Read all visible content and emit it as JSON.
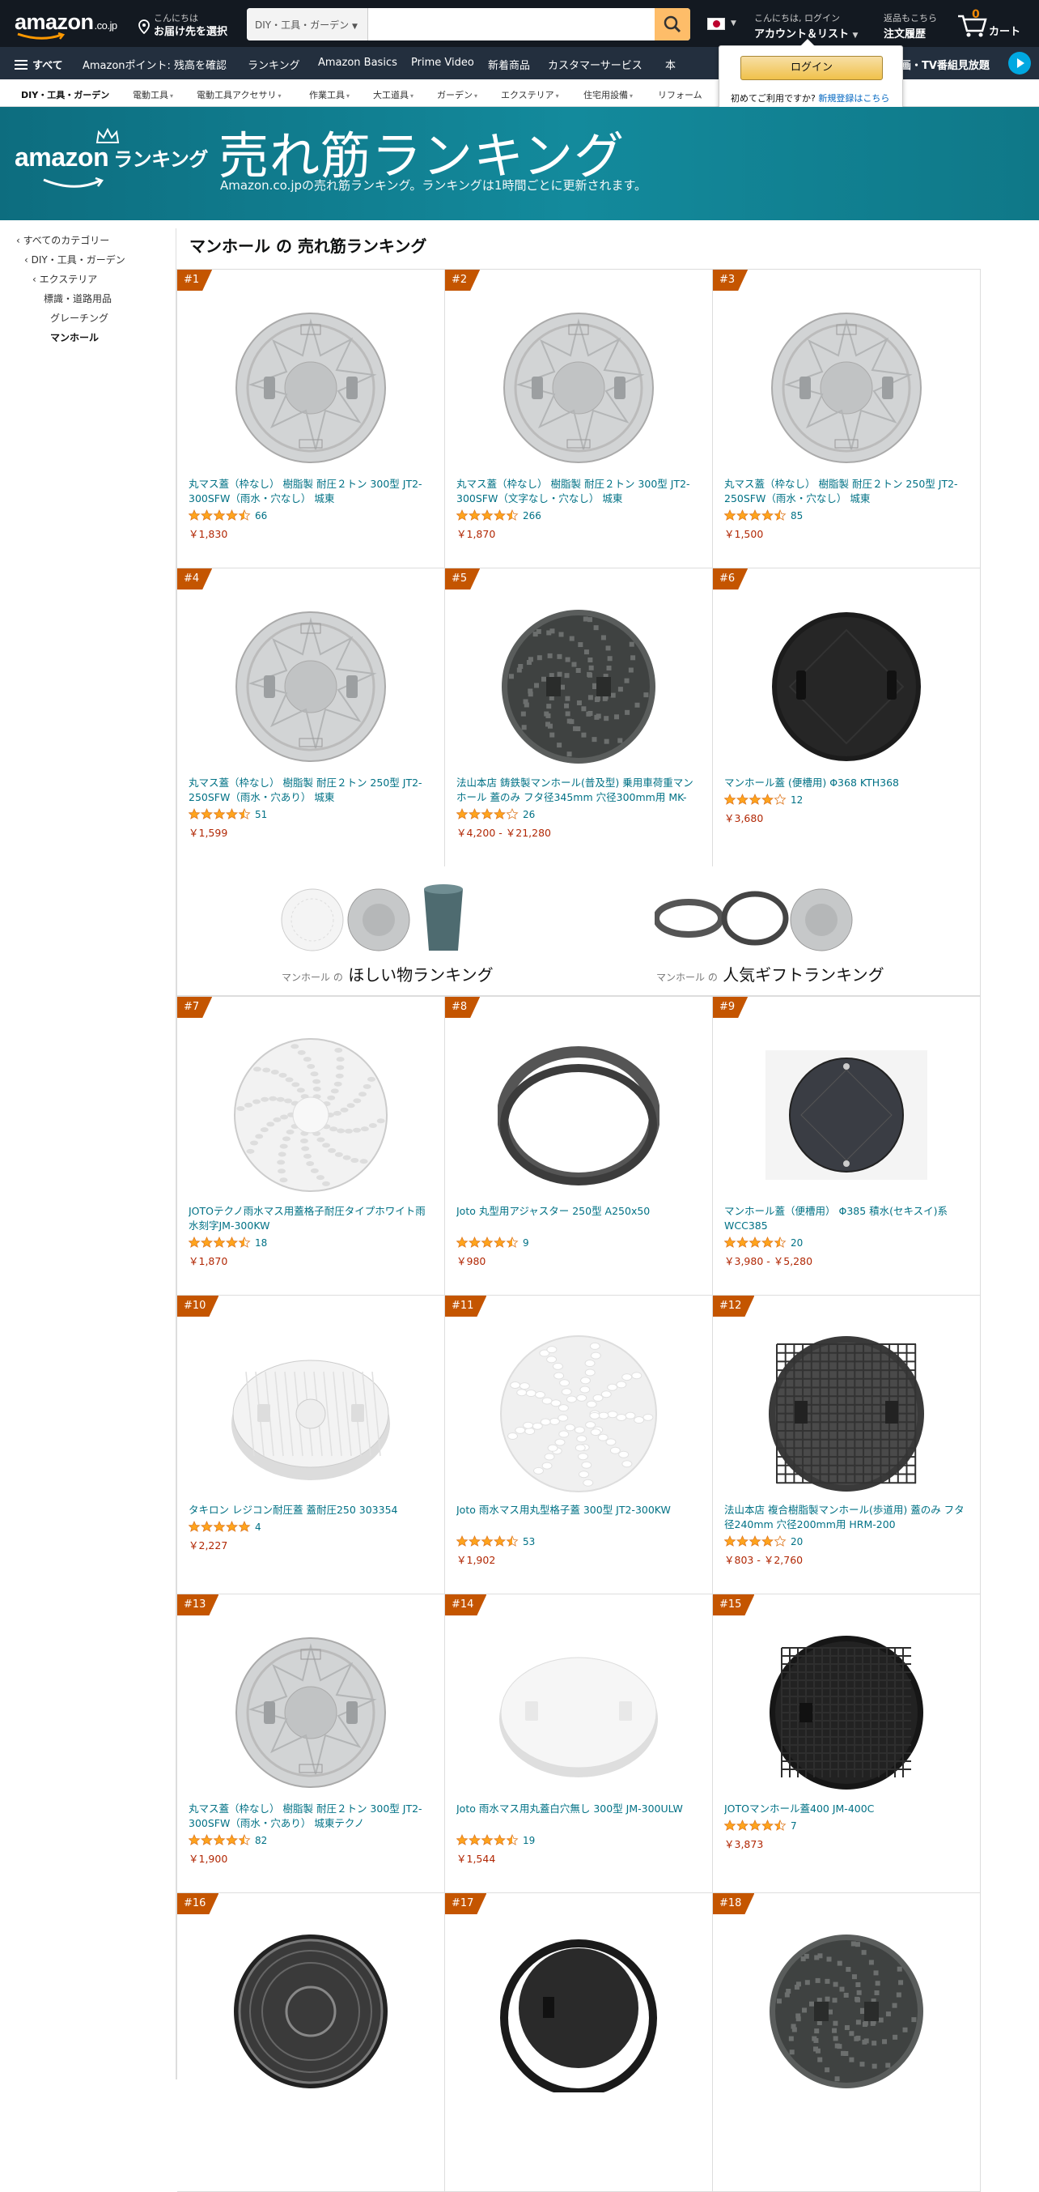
{
  "header": {
    "logo": "amazon",
    "logo_tld": ".co.jp",
    "deliver_line1": "こんにちは",
    "deliver_line2": "お届け先を選択",
    "search_category": "DIY・工具・ガーデン",
    "search_placeholder": "",
    "account_line1": "こんにちは, ログイン",
    "account_line2": "アカウント＆リスト",
    "orders_line1": "返品もこちら",
    "orders_line2": "注文履歴",
    "cart_count": "0",
    "cart_label": "カート"
  },
  "nav2": {
    "all": "すべて",
    "items": [
      "Amazonポイント: 残高を確認",
      "ランキング",
      "Amazon Basics",
      "Prime Video",
      "新着商品",
      "カスタマーサービス",
      "本"
    ],
    "promo": "映画・TV番組見放題"
  },
  "subnav": {
    "items": [
      "DIY・工具・ガーデン",
      "電動工具",
      "電動工具アクセサリ",
      "作業工具",
      "大工道具",
      "ガーデン",
      "エクステリア",
      "住宅用設備",
      "リフォーム"
    ]
  },
  "popover": {
    "login": "ログイン",
    "first_time": "初めてご利用ですか?",
    "register": "新規登録はこちら"
  },
  "banner": {
    "brand": "amazon",
    "brand2": "ランキング",
    "title": "売れ筋ランキング",
    "subtitle": "Amazon.co.jpの売れ筋ランキング。ランキングは1時間ごとに更新されます。"
  },
  "sidebar": {
    "items": [
      "‹ すべてのカテゴリー",
      "‹ DIY・工具・ガーデン",
      "‹ エクステリア",
      "標識・道路用品",
      "グレーチング",
      "マンホール"
    ]
  },
  "main": {
    "heading": "マンホール の 売れ筋ランキング"
  },
  "promo": {
    "wish_small": "マンホール の",
    "wish_big": "ほしい物ランキング",
    "gift_small": "マンホール の",
    "gift_big": "人気ギフトランキング"
  },
  "colors": {
    "nav_bg": "#131921",
    "nav2_bg": "#232f3e",
    "banner": "#138a9c",
    "rank_badge": "#c45500",
    "price": "#b12704",
    "link": "#007185",
    "star": "#ffa41c",
    "search_btn": "#febd69"
  },
  "products": [
    {
      "rank": "#1",
      "title": "丸マス蓋（枠なし） 樹脂製 耐圧２トン 300型 JT2-300SFW（雨水・穴なし） 城東",
      "rating": 4.5,
      "reviews": "66",
      "price": "￥1,830",
      "img": "gray"
    },
    {
      "rank": "#2",
      "title": "丸マス蓋（枠なし） 樹脂製 耐圧２トン 300型 JT2-300SFW（文字なし・穴なし） 城東",
      "rating": 4.5,
      "reviews": "266",
      "price": "￥1,870",
      "img": "gray"
    },
    {
      "rank": "#3",
      "title": "丸マス蓋（枠なし） 樹脂製 耐圧２トン 250型 JT2-250SFW（雨水・穴なし） 城東",
      "rating": 4.5,
      "reviews": "85",
      "price": "￥1,500",
      "img": "gray"
    },
    {
      "rank": "#4",
      "title": "丸マス蓋（枠なし） 樹脂製 耐圧２トン 250型 JT2-250SFW（雨水・穴あり） 城東",
      "rating": 4.5,
      "reviews": "51",
      "price": "￥1,599",
      "img": "gray"
    },
    {
      "rank": "#5",
      "title": "法山本店 鋳鉄製マンホール(普及型) 乗用車荷重マンホール 蓋のみ フタ径345mm 穴径300mm用 MK-1...",
      "rating": 4,
      "reviews": "26",
      "price": "￥4,200 - ￥21,280",
      "img": "iron"
    },
    {
      "rank": "#6",
      "title": "マンホール蓋 (便槽用) Φ368 KTH368",
      "rating": 4,
      "reviews": "12",
      "price": "￥3,680",
      "img": "black"
    },
    {
      "rank": "#7",
      "title": "JOTOテクノ雨水マス用蓋格子耐圧タイプホワイト雨水刻字JM-300KW",
      "rating": 4.5,
      "reviews": "18",
      "price": "￥1,870",
      "img": "white-grate"
    },
    {
      "rank": "#8",
      "title": "Joto 丸型用アジャスター 250型 A250x50",
      "rating": 4.5,
      "reviews": "9",
      "price": "￥980",
      "img": "ring"
    },
    {
      "rank": "#9",
      "title": "マンホール蓋（便槽用） Φ385 積水(セキスイ)系 WCC385",
      "rating": 4.5,
      "reviews": "20",
      "price": "￥3,980 - ￥5,280",
      "img": "dark-square"
    },
    {
      "rank": "#10",
      "title": "タキロン レジコン耐圧蓋 蓋耐圧250 303354",
      "rating": 5,
      "reviews": "4",
      "price": "￥2,227",
      "img": "white-dome"
    },
    {
      "rank": "#11",
      "title": "Joto 雨水マス用丸型格子蓋 300型 JT2-300KW",
      "rating": 4.5,
      "reviews": "53",
      "price": "￥1,902",
      "img": "white-grate2"
    },
    {
      "rank": "#12",
      "title": "法山本店 複合樹脂製マンホール(歩道用) 蓋のみ フタ径240mm 穴径200mm用 HRM-200",
      "rating": 4,
      "reviews": "20",
      "price": "￥803 - ￥2,760",
      "img": "dark-grid"
    },
    {
      "rank": "#13",
      "title": "丸マス蓋（枠なし） 樹脂製 耐圧２トン 300型 JT2-300SFW（雨水・穴あり） 城東テクノ",
      "rating": 4.5,
      "reviews": "82",
      "price": "￥1,900",
      "img": "gray"
    },
    {
      "rank": "#14",
      "title": "Joto 雨水マス用丸蓋白穴無し 300型 JM-300ULW",
      "rating": 4.5,
      "reviews": "19",
      "price": "￥1,544",
      "img": "white-plain"
    },
    {
      "rank": "#15",
      "title": "JOTOマンホール蓋400 JM-400C",
      "rating": 4.5,
      "reviews": "7",
      "price": "￥3,873",
      "img": "black2"
    },
    {
      "rank": "#16",
      "title": "",
      "rating": 0,
      "reviews": "",
      "price": "",
      "img": "iron2"
    },
    {
      "rank": "#17",
      "title": "",
      "rating": 0,
      "reviews": "",
      "price": "",
      "img": "black-ring"
    },
    {
      "rank": "#18",
      "title": "",
      "rating": 0,
      "reviews": "",
      "price": "",
      "img": "iron"
    }
  ]
}
